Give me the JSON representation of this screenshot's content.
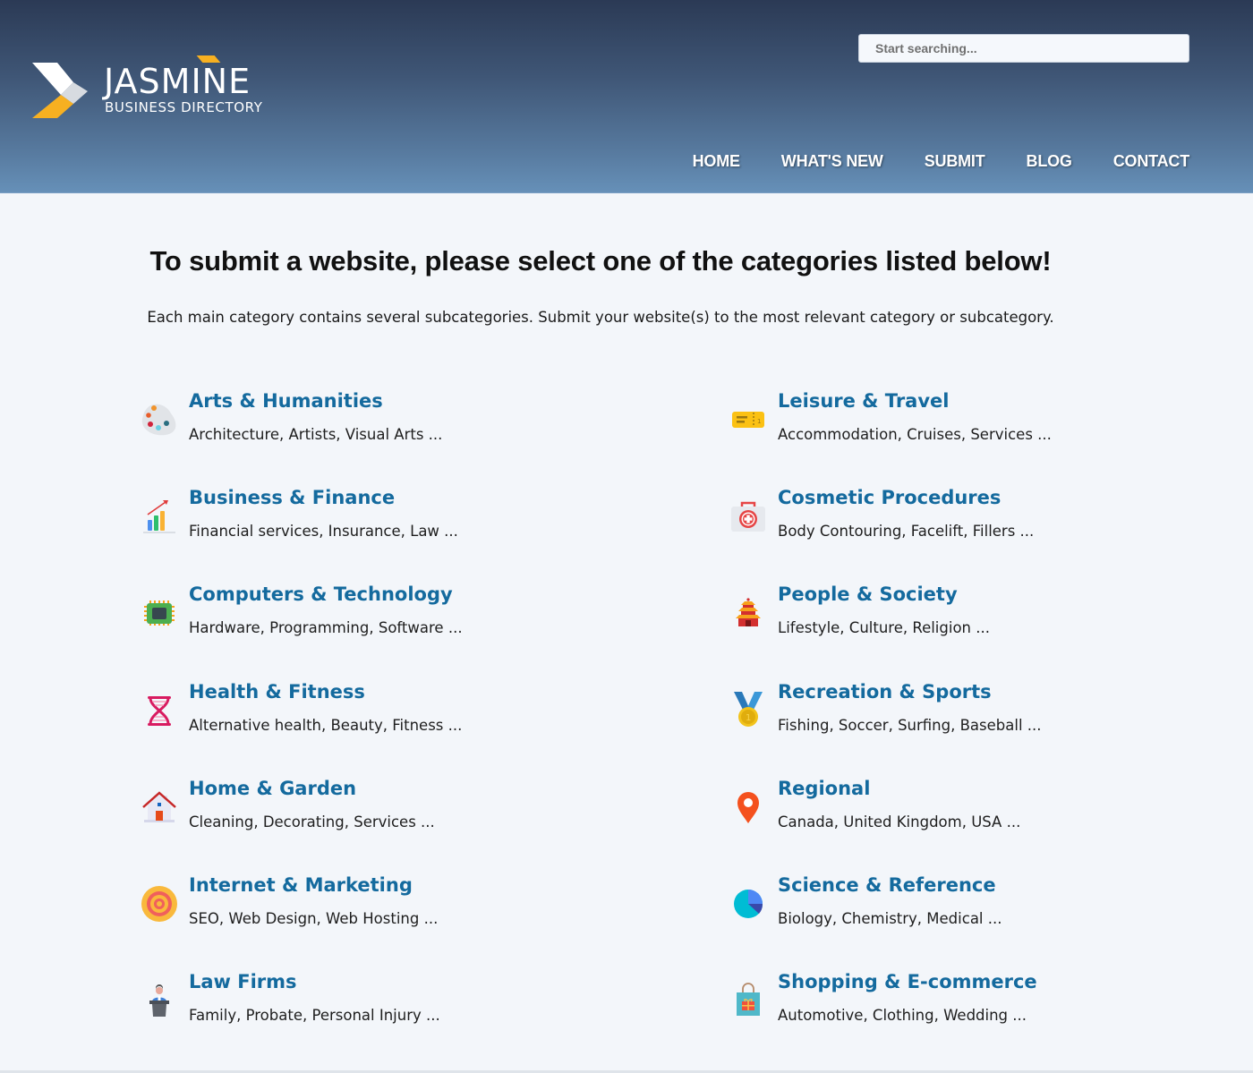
{
  "header": {
    "logo": {
      "title": "JASMINE",
      "subtitle": "BUSINESS DIRECTORY"
    },
    "search": {
      "placeholder": "Start searching..."
    },
    "nav": [
      {
        "label": "HOME"
      },
      {
        "label": "WHAT'S NEW"
      },
      {
        "label": "SUBMIT"
      },
      {
        "label": "BLOG"
      },
      {
        "label": "CONTACT"
      }
    ]
  },
  "main": {
    "heading": "To submit a website, please select one of the categories listed below!",
    "intro": "Each main category contains several subcategories. Submit your website(s) to the most relevant category or subcategory.",
    "categories": [
      {
        "title": "Arts & Humanities",
        "subs": "Architecture, Artists, Visual Arts ...",
        "icon": "palette-icon"
      },
      {
        "title": "Leisure & Travel",
        "subs": "Accommodation, Cruises, Services ...",
        "icon": "ticket-icon"
      },
      {
        "title": "Business & Finance",
        "subs": "Financial services, Insurance, Law ...",
        "icon": "bar-chart-icon"
      },
      {
        "title": "Cosmetic Procedures",
        "subs": "Body Contouring, Facelift, Fillers ...",
        "icon": "first-aid-kit-icon"
      },
      {
        "title": "Computers & Technology",
        "subs": "Hardware, Programming, Software ...",
        "icon": "cpu-chip-icon"
      },
      {
        "title": "People & Society",
        "subs": "Lifestyle, Culture, Religion ...",
        "icon": "pagoda-icon"
      },
      {
        "title": "Health & Fitness",
        "subs": "Alternative health, Beauty, Fitness ...",
        "icon": "dna-icon"
      },
      {
        "title": "Recreation & Sports",
        "subs": "Fishing, Soccer, Surfing, Baseball ...",
        "icon": "medal-icon"
      },
      {
        "title": "Home & Garden",
        "subs": "Cleaning, Decorating, Services ...",
        "icon": "house-icon"
      },
      {
        "title": "Regional",
        "subs": "Canada, United Kingdom, USA ...",
        "icon": "map-pin-icon"
      },
      {
        "title": "Internet & Marketing",
        "subs": "SEO, Web Design, Web Hosting ...",
        "icon": "target-icon"
      },
      {
        "title": "Science & Reference",
        "subs": "Biology, Chemistry, Medical ...",
        "icon": "pie-chart-icon"
      },
      {
        "title": "Law Firms",
        "subs": "Family, Probate, Personal Injury ...",
        "icon": "lawyer-podium-icon"
      },
      {
        "title": "Shopping & E-commerce",
        "subs": "Automotive, Clothing, Wedding ...",
        "icon": "shopping-bag-icon"
      }
    ]
  },
  "colors": {
    "link": "#146a9e",
    "accent": "#f7b021",
    "header_top": "#2b3a55",
    "header_bottom": "#6690b8",
    "background": "#f3f6fa"
  }
}
